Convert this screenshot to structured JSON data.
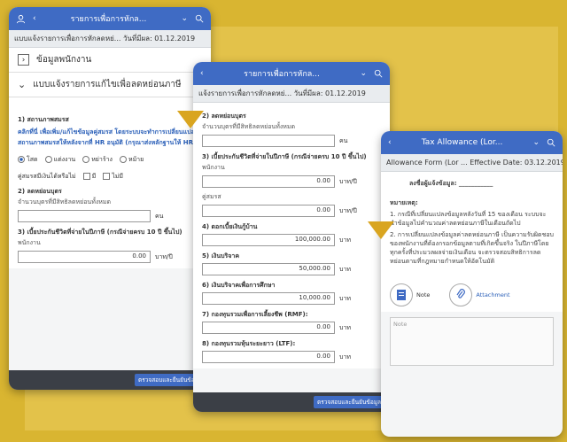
{
  "screen1": {
    "header_title": "รายการเพื่อการหักล...",
    "subheader": "แบบแจ้งรายการเพื่อการหักลดหย่... วันที่มีผล: 01.12.2019",
    "section_employee": "ข้อมูลพนักงาน",
    "section_tax": "แบบแจ้งรายการแก้ไขเพื่อลดหย่อนภาษี",
    "marital_label": "1) สถานภาพสมรส",
    "marital_link": "คลิกที่นี่ เพื่อเพิ่ม/แก้ไขข้อมูลคู่สมรส โดยระบบจะทำการเปลี่ยนแปลงสถานภาพสมรสให้หลังจากที่ HR อนุมัติ (กรุณาส่งหลักฐานให้ HR)",
    "radio_options": [
      "โสด",
      "แต่งงาน",
      "หย่าร้าง",
      "หม้าย"
    ],
    "spouse_income_label": "คู่สมรสมีเงินได้หรือไม่",
    "check_yes": "มี",
    "check_no": "ไม่มี",
    "child_label": "2) ลดหย่อนบุตร",
    "child_sub": "จำนวนบุตรที่มีสิทธิลดหย่อนทั้งหมด",
    "child_unit": "คน",
    "insurance_label": "3) เบี้ยประกันชีวิตที่จ่ายในปีภาษี (กรณีจ่ายครบ 10 ปี ขึ้นไป)",
    "employee_sub": "พนักงาน",
    "employee_value": "0.00",
    "unit_baht_year": "บาท/ปี",
    "footer_button": "ตรวจสอบและยืนยันข้อมูล"
  },
  "screen2": {
    "header_title": "รายการเพื่อการหักล...",
    "subheader": "แจ้งรายการเพื่อการหักลดหย่... วันที่มีผล: 01.12.2019",
    "child_label": "2) ลดหย่อนบุตร",
    "child_sub": "จำนวนบุตรที่มีสิทธิลดหย่อนทั้งหมด",
    "child_unit": "คน",
    "insurance_label": "3) เบี้ยประกันชีวิตที่จ่ายในปีภาษี (กรณีจ่ายครบ 10 ปี ขึ้นไป)",
    "employee_sub": "พนักงาน",
    "employee_value": "0.00",
    "spouse_sub": "คู่สมรส",
    "spouse_value": "0.00",
    "unit_baht_year": "บาท/ปี",
    "unit_baht": "บาท",
    "interest_label": "4) ดอกเบี้ยเงินกู้บ้าน",
    "interest_value": "100,000.00",
    "donation_label": "5) เงินบริจาค",
    "donation_value": "50,000.00",
    "edu_label": "6) เงินบริจาคเพื่อการศึกษา",
    "edu_value": "10,000.00",
    "rmf_label": "7) กองทุนรวมเพื่อการเลี้ยงชีพ (RMF):",
    "rmf_value": "0.00",
    "ltf_label": "8) กองทุนรวมหุ้นระยะยาว (LTF):",
    "ltf_value": "0.00",
    "footer_button": "ตรวจสอบและยืนยันข้อมูล"
  },
  "screen3": {
    "header_title": "Tax Allowance (Lor...",
    "subheader": "Allowance Form (Lor ... Effective Date: 03.12.2019",
    "signature_label": "ลงชื่อผู้แจ้งข้อมูล: ___________",
    "notes_title": "หมายเหตุ:",
    "note1": "1. กรณีที่เปลี่ยนแปลงข้อมูลหลังวันที่ 15 ของเดือน ระบบจะนำข้อมูลไปคำนวณค่าลดหย่อนภาษีในเดือนถัดไป",
    "note2": "2. การเปลี่ยนแปลงข้อมูลค่าลดหย่อนภาษี เป็นความรับผิดชอบของพนักงานที่ต้องกรอกข้อมูลตามที่เกิดขึ้นจริง ในปีภาษีโดยทุกครั้งที่ประมวลผลจ่ายเงินเดือน จะตรวจสอบสิทธิการลดหย่อนตามที่กฎหมายกำหนดให้อัตโนมัติ",
    "note_label": "Note",
    "attachment_label": "Attachment",
    "note_placeholder": "Note"
  }
}
